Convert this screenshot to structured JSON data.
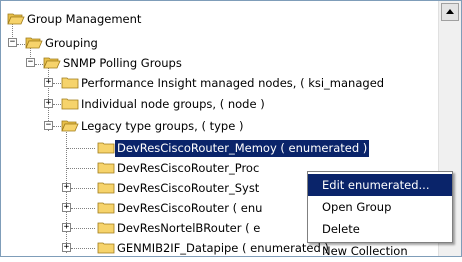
{
  "tree": {
    "nodes": [
      {
        "label": "Group Management"
      },
      {
        "label": "Grouping",
        "expander": "−"
      },
      {
        "label": "SNMP Polling Groups",
        "expander": "−"
      },
      {
        "label": "Performance Insight managed nodes, ( ksi_managed",
        "expander": "+"
      },
      {
        "label": "Individual node groups, ( node )",
        "expander": "+"
      },
      {
        "label": "Legacy type groups, ( type )",
        "expander": "−"
      },
      {
        "label": "DevResCiscoRouter_Memo",
        "label_tail": "y ( enumerated )",
        "selected": true
      },
      {
        "label": "DevResCiscoRouter_Proc"
      },
      {
        "label": "DevResCiscoRouter_Syst",
        "expander": "+"
      },
      {
        "label": "DevResCiscoRouter ( enu",
        "expander": "+"
      },
      {
        "label": "DevResNortelBRouter ( e",
        "expander": "+"
      },
      {
        "label": "GENMIB2IF_Datapipe ( enumerated )",
        "expander": "+"
      }
    ]
  },
  "context_menu": {
    "items": [
      {
        "label": "Edit enumerated...",
        "highlighted": true
      },
      {
        "label": "Open Group"
      },
      {
        "label": "Delete"
      },
      {
        "label": "New Collection"
      }
    ]
  },
  "colors": {
    "selection": "#0a246a",
    "folder": "#f6d36b",
    "folder_edge": "#b08a20"
  }
}
